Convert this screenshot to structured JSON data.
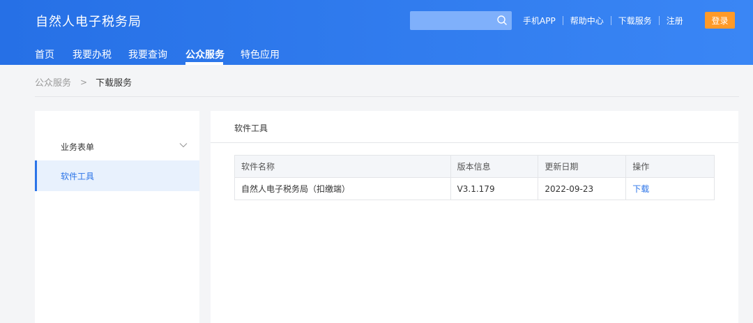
{
  "header": {
    "site_title": "自然人电子税务局",
    "search_placeholder": "",
    "links": [
      "手机APP",
      "帮助中心",
      "下载服务",
      "注册"
    ],
    "login_label": "登录",
    "accent_color": "#2b74e8",
    "login_color": "#ff9a28"
  },
  "nav": {
    "items": [
      "首页",
      "我要办税",
      "我要查询",
      "公众服务",
      "特色应用"
    ],
    "active": "公众服务"
  },
  "breadcrumb": {
    "parent": "公众服务",
    "separator": ">",
    "current": "下载服务"
  },
  "sidebar": {
    "items": [
      {
        "label": "业务表单",
        "icon": "chevron-down-icon"
      },
      {
        "label": "软件工具",
        "selected": true
      }
    ]
  },
  "panel": {
    "title": "软件工具",
    "table": {
      "headers": [
        "软件名称",
        "版本信息",
        "更新日期",
        "操作"
      ],
      "rows": [
        [
          "自然人电子税务局（扣缴端）",
          "V3.1.179",
          "2022-09-23",
          "下载"
        ]
      ]
    }
  }
}
